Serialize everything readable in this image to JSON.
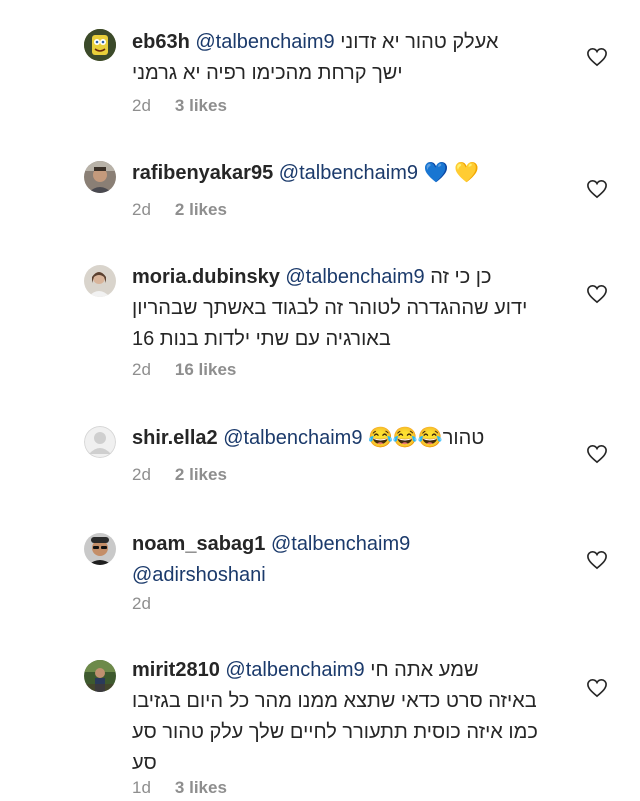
{
  "comments": [
    {
      "username": "eb63h",
      "lines": [
        {
          "mention": "@talbenchaim9",
          "text": "אעלק טהור יא זדוני"
        },
        {
          "text": "ישך קרחת מהכימו רפיה יא גרמני"
        }
      ],
      "time": "2d",
      "likes": "3 likes",
      "avatar": "spongebob-avatar"
    },
    {
      "username": "rafibenyakar95",
      "lines": [
        {
          "mention": "@talbenchaim9",
          "text": "💙 💛"
        }
      ],
      "time": "2d",
      "likes": "2 likes",
      "avatar": "man-avatar"
    },
    {
      "username": "moria.dubinsky",
      "lines": [
        {
          "mention": "@talbenchaim9",
          "text": "כן כי זה"
        },
        {
          "text": "ידוע שההגדרה לטוהר זה לבגוד באשתך שבהריון"
        },
        {
          "text": "באורגיה עם שתי ילדות בנות 16"
        }
      ],
      "time": "2d",
      "likes": "16 likes",
      "avatar": "woman-avatar"
    },
    {
      "username": "shir.ella2",
      "lines": [
        {
          "mention": "@talbenchaim9",
          "text": "טהור😂😂😂"
        }
      ],
      "time": "2d",
      "likes": "2 likes",
      "avatar": "default-avatar"
    },
    {
      "username": "noam_sabag1",
      "lines": [
        {
          "mention": "@talbenchaim9",
          "text": ""
        },
        {
          "mention": "@adirshoshani",
          "text": ""
        }
      ],
      "time": "2d",
      "likes": "",
      "avatar": "sunglasses-avatar"
    },
    {
      "username": "mirit2810",
      "lines": [
        {
          "mention": "@talbenchaim9",
          "text": "שמע אתה חי"
        },
        {
          "text": "באיזה סרט כדאי שתצא ממנו מהר כל היום בגזיבו"
        },
        {
          "text": "כמו איזה כוסית תתעורר לחיים שלך עלק טהור סע"
        },
        {
          "text": "סע"
        }
      ],
      "time": "1d",
      "likes": "3 likes",
      "avatar": "outdoor-avatar"
    }
  ],
  "colors": {
    "mention": "#1b3a6b",
    "meta": "#8e8e8e",
    "text": "#262626"
  }
}
